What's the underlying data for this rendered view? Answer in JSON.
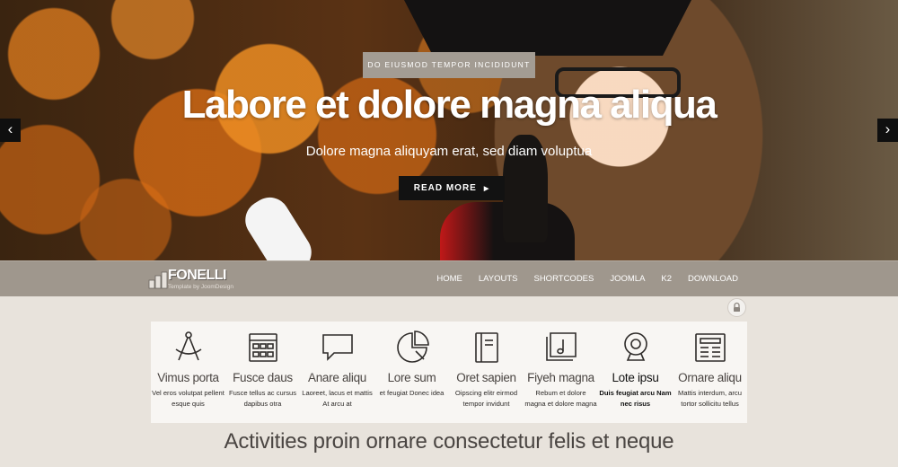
{
  "hero": {
    "tag": "DO EIUSMOD TEMPOR INCIDIDUNT",
    "title": "Labore et dolore magna aliqua",
    "subtitle": "Dolore magna aliquyam erat, sed diam voluptua",
    "button_label": "READ MORE",
    "button_arrow": "▶",
    "prev_arrow": "‹",
    "next_arrow": "›"
  },
  "navbar": {
    "logo_text": "FONELLI",
    "logo_tagline": "Template by JoomDesign",
    "menu": [
      "HOME",
      "LAYOUTS",
      "SHORTCODES",
      "JOOMLA",
      "K2",
      "DOWNLOAD"
    ]
  },
  "features": [
    {
      "icon": "compass-icon",
      "title": "Vimus porta",
      "desc": "Vel eros volutpat pellent esque quis"
    },
    {
      "icon": "calendar-icon",
      "title": "Fusce daus",
      "desc": "Fusce tellus ac cursus dapibus otra"
    },
    {
      "icon": "chat-bubble-icon",
      "title": "Anare aliqu",
      "desc": "Laoreet, lacus et mattis At arcu at"
    },
    {
      "icon": "pie-chart-icon",
      "title": "Lore sum",
      "desc": "et feugiat Donec idea"
    },
    {
      "icon": "document-icon",
      "title": "Oret sapien",
      "desc": "Oipscing elitr eirmod tempor invidunt"
    },
    {
      "icon": "music-book-icon",
      "title": "Fiyeh magna",
      "desc": "Rebum et dolore magna et dolore magna"
    },
    {
      "icon": "webcam-icon",
      "title": "Lote ipsu",
      "desc": "Duis feugiat arcu Nam nec risus",
      "emphasis": true
    },
    {
      "icon": "newspaper-icon",
      "title": "Ornare aliqu",
      "desc": "Mattis interdum, arcu tortor sollicitu tellus"
    }
  ],
  "section_heading": "Activities proin ornare consectetur felis et neque",
  "colors": {
    "navbar": "#9f978d",
    "page_background": "#e8e3dc",
    "features_background": "#f8f6f3",
    "button": "#121212",
    "tag_background": "#a39c93"
  }
}
